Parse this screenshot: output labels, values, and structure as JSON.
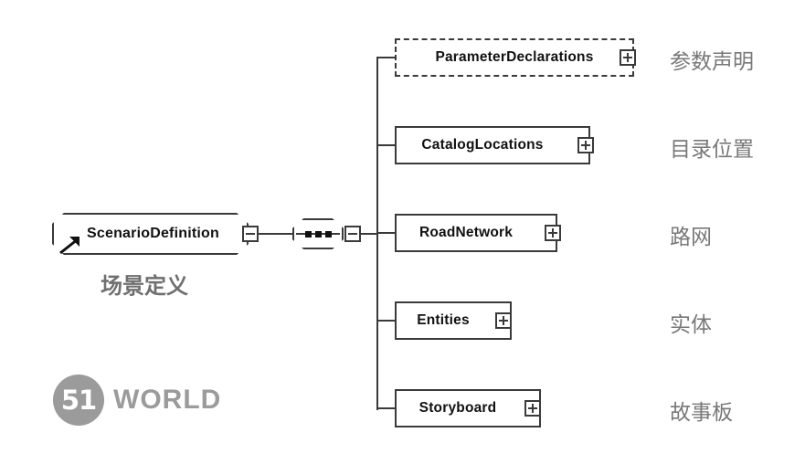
{
  "diagram": {
    "type": "xsd-schema-tree",
    "root": {
      "name": "ScenarioDefinition",
      "annotation": "场景定义",
      "toggle": "minus-toggle",
      "compositor": "sequence"
    },
    "children": [
      {
        "name": "ParameterDeclarations",
        "annotation": "参数声明",
        "occurrence": "optional",
        "toggle": "plus-toggle"
      },
      {
        "name": "CatalogLocations",
        "annotation": "目录位置",
        "occurrence": "required",
        "toggle": "plus-toggle"
      },
      {
        "name": "RoadNetwork",
        "annotation": "路网",
        "occurrence": "required",
        "toggle": "plus-toggle"
      },
      {
        "name": "Entities",
        "annotation": "实体",
        "occurrence": "required",
        "toggle": "plus-toggle"
      },
      {
        "name": "Storyboard",
        "annotation": "故事板",
        "occurrence": "required",
        "toggle": "plus-toggle"
      }
    ]
  },
  "logo": {
    "mark": "51",
    "text": "WORLD"
  },
  "colors": {
    "line": "#3a3a3a",
    "text": "#111111",
    "annotation": "#787878",
    "logo": "#9b9b9b",
    "background": "#ffffff"
  }
}
